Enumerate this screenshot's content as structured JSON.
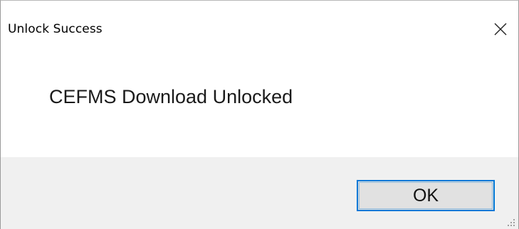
{
  "window": {
    "title": "Unlock Success",
    "close_icon": "close-icon"
  },
  "message": {
    "text": "CEFMS Download Unlocked"
  },
  "footer": {
    "ok_label": "OK",
    "accent_color": "#0078d7",
    "background_color": "#f0f0f0",
    "resize_icon": "resize-grip-icon"
  }
}
